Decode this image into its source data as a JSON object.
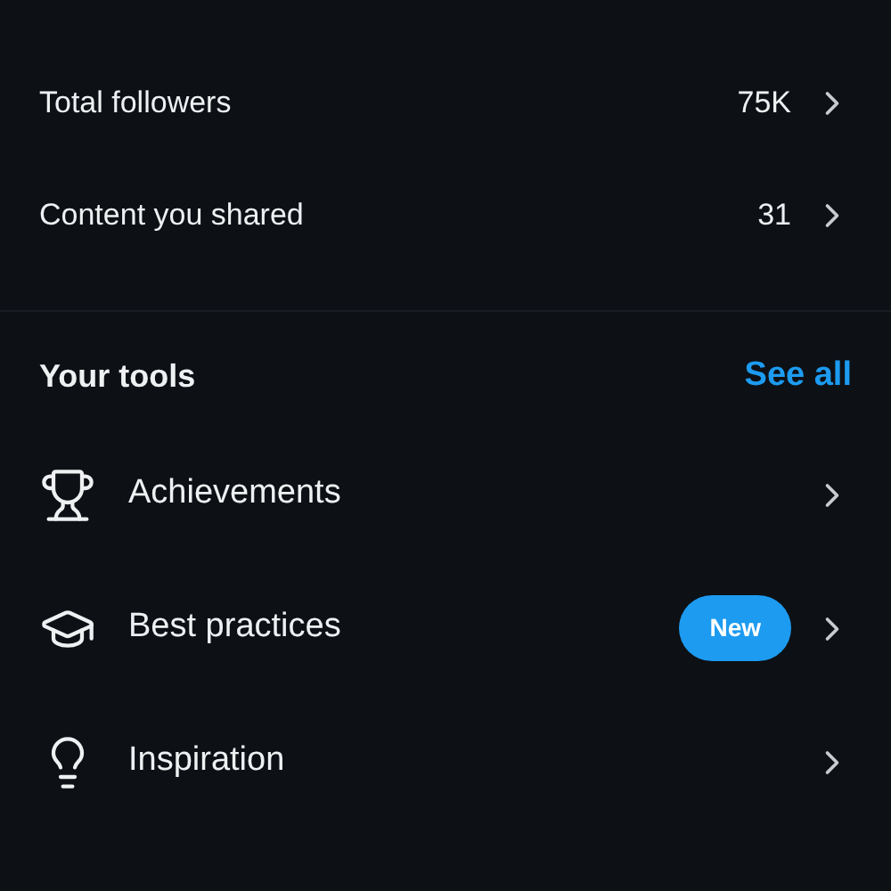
{
  "stats": [
    {
      "label": "Total followers",
      "value": "75K"
    },
    {
      "label": "Content you shared",
      "value": "31"
    }
  ],
  "tools_section": {
    "title": "Your tools",
    "link": "See all"
  },
  "tools": [
    {
      "kind": "trophy",
      "label": "Achievements"
    },
    {
      "kind": "cap",
      "label": "Best practices",
      "badge": "New"
    },
    {
      "kind": "bulb",
      "label": "Inspiration"
    }
  ]
}
